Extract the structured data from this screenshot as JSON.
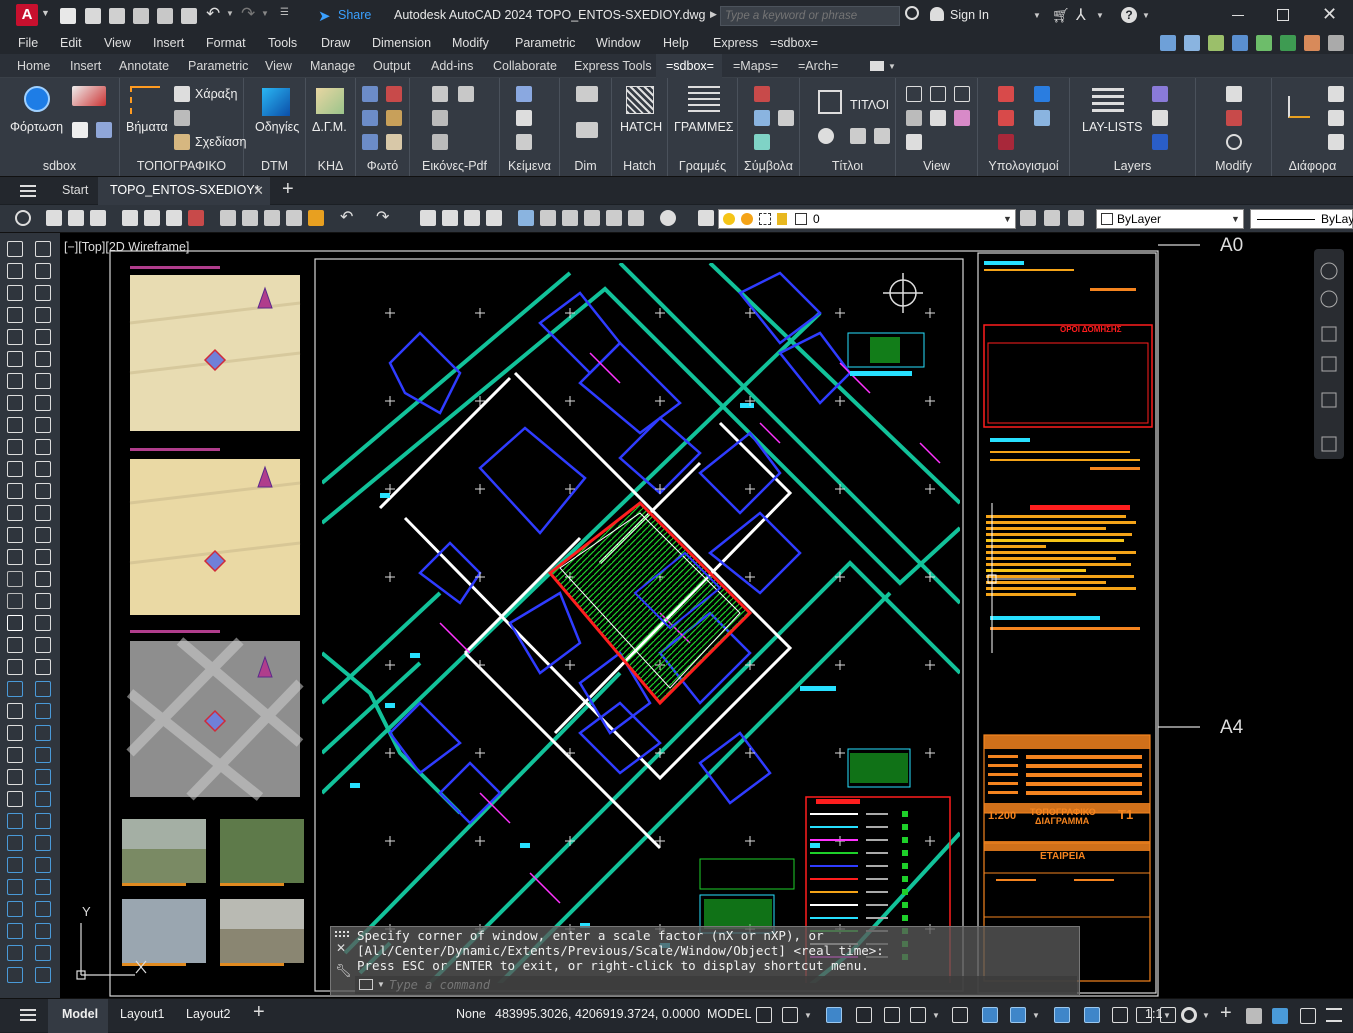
{
  "title_bar": {
    "app_logo": "A",
    "share_label": "Share",
    "app_name": "Autodesk AutoCAD 2024",
    "file_name": "TOPO_ENTOS-SXEDIOY.dwg",
    "search_placeholder": "Type a keyword or phrase",
    "sign_in": "Sign In"
  },
  "menu": [
    "File",
    "Edit",
    "View",
    "Insert",
    "Format",
    "Tools",
    "Draw",
    "Dimension",
    "Modify",
    "Parametric",
    "Window",
    "Help",
    "Express",
    "=sdbox="
  ],
  "ribbon_tabs": [
    "Home",
    "Insert",
    "Annotate",
    "Parametric",
    "View",
    "Manage",
    "Output",
    "Add-ins",
    "Collaborate",
    "Express Tools",
    "=sdbox=",
    "=Maps=",
    "=Arch="
  ],
  "ribbon_active_tab": "=sdbox=",
  "ribbon": {
    "btn_fortosi": "Φόρτωση",
    "btn_vimata": "Βήματα",
    "btn_charaxi": "Χάραξη",
    "btn_schediasi": "Σχεδίαση",
    "btn_odigies": "Οδηγίες",
    "btn_dgm": "Δ.Γ.Μ.",
    "btn_hatch": "HATCH",
    "btn_grammes": "ΓΡΑΜΜΕΣ",
    "btn_titloi": "ΤΙΤΛΟΙ",
    "btn_laylists": "LAY-LISTS",
    "panels": [
      "sdbox",
      "ΤΟΠΟΓΡΑΦΙΚΟ",
      "DTM",
      "ΚΗΔ",
      "Φωτό",
      "Εικόνες-Pdf",
      "Κείμενα",
      "Dim",
      "Hatch",
      "Γραμμές",
      "Σύμβολα",
      "Τίτλοι",
      "View",
      "Υπολογισμοί",
      "Layers",
      "Modify",
      "Διάφορα"
    ]
  },
  "doc_tabs": {
    "start": "Start",
    "active": "TOPO_ENTOS-SXEDIOY*"
  },
  "props_toolbar": {
    "layer_value": "0",
    "color_value": "ByLayer",
    "linetype_value": "ByLay"
  },
  "viewport_label": "[−][Top][2D Wireframe]",
  "sheet_labels": {
    "a0": "A0",
    "a4": "A4"
  },
  "ucs": {
    "y_label": "Y"
  },
  "title_block": {
    "scale": "1:200",
    "title_line1": "ΤΟΠΟΓΡΑΦΙΚΟ",
    "title_line2": "ΔΙΑΓΡΑΜΜΑ",
    "sheet_no": "Τ1",
    "company": "ΕΤΑΙΡΕΙΑ",
    "conditions_header": "ΟΡΟΙ ΔΟΜΗΣΗΣ"
  },
  "command": {
    "line1": "Specify corner of window, enter a scale factor (nX or nXP), or",
    "line2": "[All/Center/Dynamic/Extents/Previous/Scale/Window/Object] <real time>:",
    "line3": "Press ESC or ENTER to exit, or right-click to display shortcut menu.",
    "placeholder": "Type a command"
  },
  "status_bar": {
    "tabs": [
      "Model",
      "Layout1",
      "Layout2"
    ],
    "active_tab": "Model",
    "snap_mode": "None",
    "coordinates": "483995.3026, 4206919.3724, 0.0000",
    "model_label": "MODEL",
    "scale": "1:1"
  },
  "colors": {
    "accent_red": "#c8102e",
    "share_blue": "#3aa0ff",
    "canvas_bg": "#000000",
    "road_green": "#12c29a",
    "wall_white": "#ffffff",
    "building_blue": "#2f3cff",
    "title_orange": "#f5841f",
    "plot_red": "#ff1e1e"
  }
}
